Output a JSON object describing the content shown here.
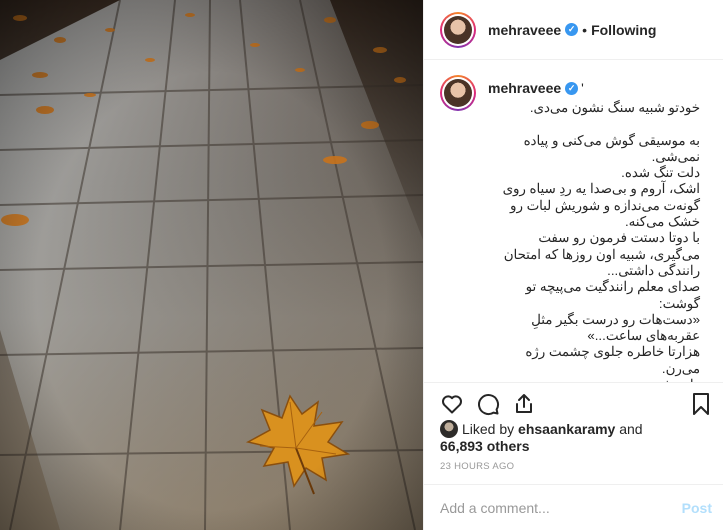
{
  "post": {
    "author": "mehraveee",
    "follow_state": "Following",
    "separator": "•",
    "caption_suffix": "'",
    "caption": "خودتو شبیه سنگ نشون می‌دی.\n\nبه موسیقی گوش می‌کنی و پیاده نمی‌شی.\nدلت تنگ شده.\nاشک، آروم و بی‌صدا یه ردِ سیاه روی گونه‌ت می‌ندازه و شوریش لبات رو خشک می‌کنه.\nبا دوتا دستت فرمون رو سفت می‌گیری، شبیه اون روزها که امتحان رانندگی داشتی...\nصدای معلم رانندگیت می‌پیچه تو گوشت:\n«دست‌هات رو درست بگیر مثلِ عقربه‌های ساعت...»\nهزارتا خاطره جلوی چشمت رژه می‌رن.\nراستش"
  },
  "likes": {
    "prefix": "Liked by",
    "user": "ehsaankaramy",
    "connector": "and",
    "count": "66,893 others"
  },
  "timestamp": "23 HOURS AGO",
  "comment": {
    "placeholder": "Add a comment...",
    "post_label": "Post"
  },
  "icons": {
    "like": "heart-icon",
    "comment": "comment-icon",
    "share": "share-icon",
    "save": "bookmark-icon",
    "verified": "verified-badge-icon"
  },
  "colors": {
    "verified_blue": "#3897f0",
    "post_button_disabled": "#b2dffc",
    "muted_text": "#999999"
  }
}
